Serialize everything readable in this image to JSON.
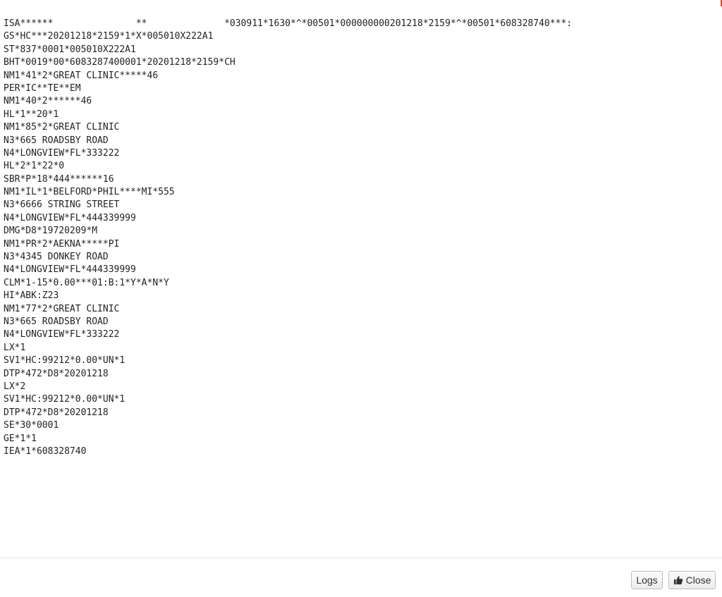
{
  "edi": {
    "lines": [
      "ISA******               **              *030911*1630*^*00501*000000000201218*2159*^*00501*608328740***:",
      "GS*HC***20201218*2159*1*X*005010X222A1",
      "ST*837*0001*005010X222A1",
      "BHT*0019*00*6083287400001*20201218*2159*CH",
      "NM1*41*2*GREAT CLINIC*****46",
      "PER*IC**TE**EM",
      "NM1*40*2******46",
      "HL*1**20*1",
      "NM1*85*2*GREAT CLINIC",
      "N3*665 ROADSBY ROAD",
      "N4*LONGVIEW*FL*333222",
      "HL*2*1*22*0",
      "SBR*P*18*444******16",
      "NM1*IL*1*BELFORD*PHIL****MI*555",
      "N3*6666 STRING STREET",
      "N4*LONGVIEW*FL*444339999",
      "DMG*D8*19720209*M",
      "NM1*PR*2*AEKNA*****PI",
      "N3*4345 DONKEY ROAD",
      "N4*LONGVIEW*FL*444339999",
      "CLM*1-15*0.00***01:B:1*Y*A*N*Y",
      "HI*ABK:Z23",
      "NM1*77*2*GREAT CLINIC",
      "N3*665 ROADSBY ROAD",
      "N4*LONGVIEW*FL*333222",
      "LX*1",
      "SV1*HC:99212*0.00*UN*1",
      "DTP*472*D8*20201218",
      "LX*2",
      "SV1*HC:99212*0.00*UN*1",
      "DTP*472*D8*20201218",
      "SE*30*0001",
      "GE*1*1",
      "IEA*1*608328740"
    ]
  },
  "footer": {
    "logs_label": "Logs",
    "close_label": "Close",
    "close_icon": "thumbs-up-icon"
  },
  "colors": {
    "text": "#222222",
    "accent": "#e0403a",
    "border": "#bdbdbd"
  }
}
